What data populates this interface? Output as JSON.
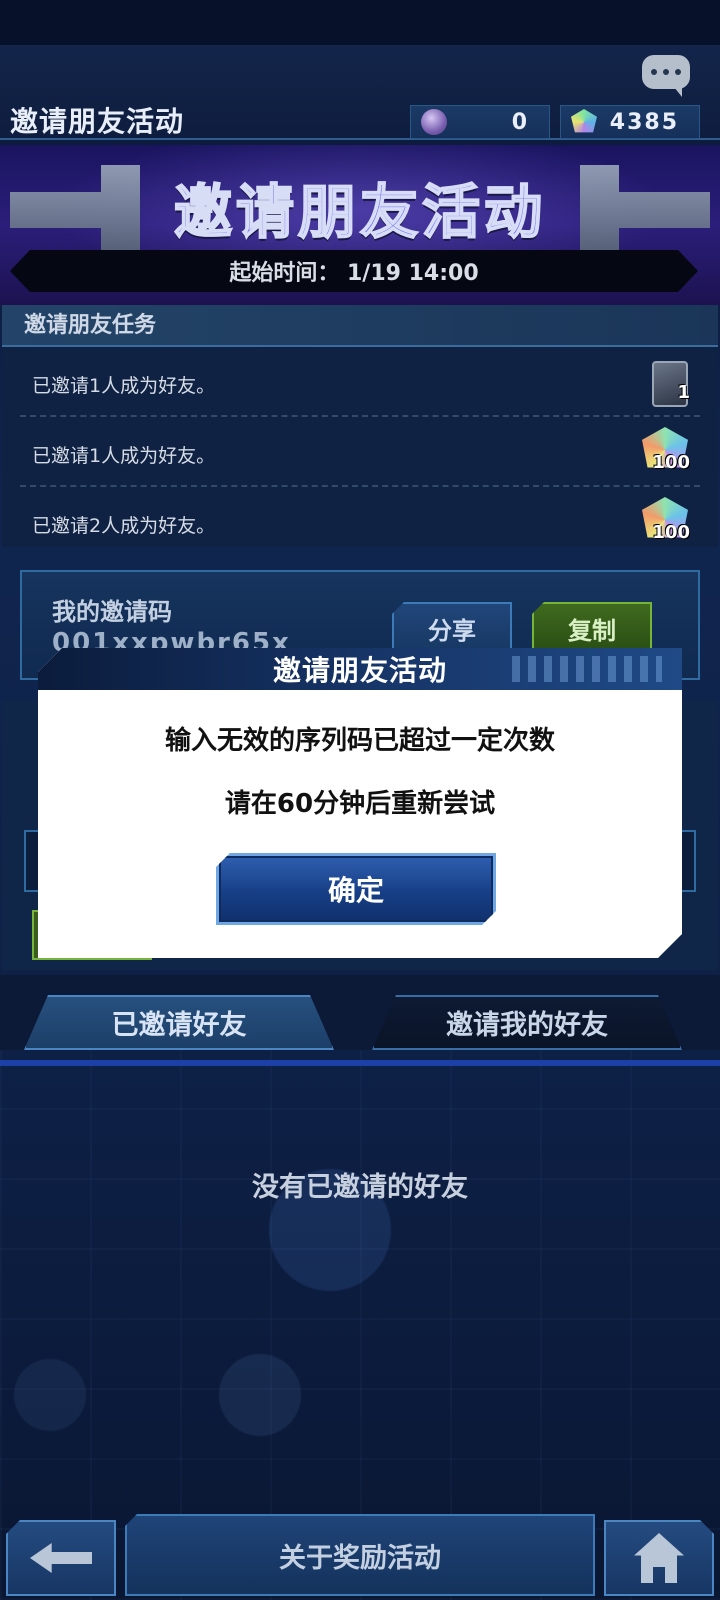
{
  "header": {
    "title": "邀请朋友活动",
    "currencies": [
      {
        "icon": "orb-icon",
        "value": "0"
      },
      {
        "icon": "gem-icon",
        "value": "4385"
      }
    ]
  },
  "banner": {
    "title": "邀请朋友活动",
    "start_time": "起始时间： 1/19 14:00"
  },
  "missions": {
    "section_title": "邀请朋友任务",
    "items": [
      {
        "text": "已邀请1人成为好友。",
        "reward_icon": "card-pack-icon",
        "count": "1"
      },
      {
        "text": "已邀请1人成为好友。",
        "reward_icon": "gem-icon",
        "count": "100"
      },
      {
        "text": "已邀请2人成为好友。",
        "reward_icon": "gem-icon",
        "count": "100"
      }
    ]
  },
  "invite_code": {
    "label": "我的邀请码",
    "value": "001xxpwbr65x",
    "share_label": "分享",
    "copy_label": "复制"
  },
  "tabs": [
    {
      "label": "已邀请好友",
      "active": true
    },
    {
      "label": "邀请我的好友",
      "active": false
    }
  ],
  "empty_message": "没有已邀请的好友",
  "bottom": {
    "about_label": "关于奖励活动"
  },
  "dialog": {
    "title": "邀请朋友活动",
    "message_line1": "输入无效的序列码已超过一定次数",
    "message_line2": "请在60分钟后重新尝试",
    "confirm_label": "确定"
  },
  "colors": {
    "accent_blue": "#1f4a86",
    "copy_green": "#3f6a1e",
    "dialog_bg": "#ffffff"
  }
}
